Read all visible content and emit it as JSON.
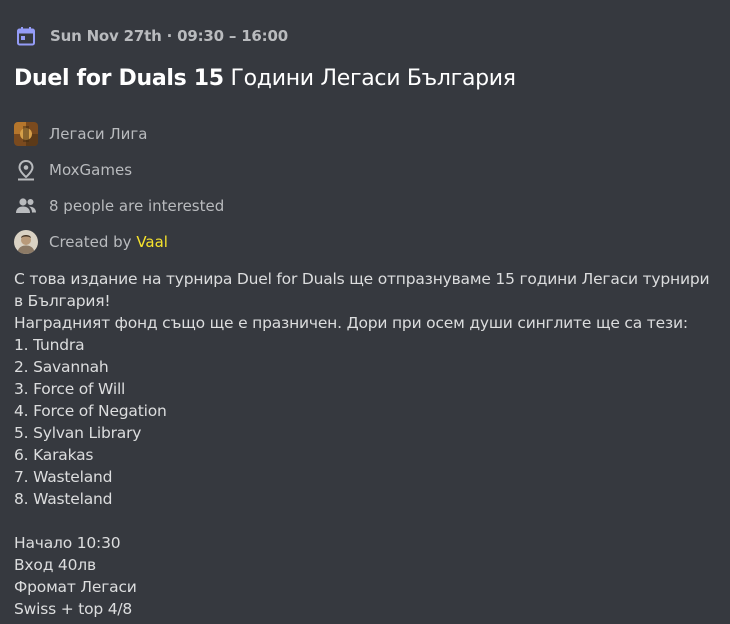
{
  "event": {
    "date": "Sun Nov 27th · 09:30 – 16:00",
    "title_bold": "Duel for Duals 15",
    "title_rest": " Години Легаси България",
    "server_name": "Легаси Лига",
    "location": "MoxGames",
    "interested": "8 people are interested",
    "created_by_label": "Created by ",
    "creator": "Vaal",
    "description": "С това издание на турнира Duel for Duals ще отпразнуваме 15 години Легаси турнири в България!\nНаградният фонд също ще е празничен. Дори при осем души синглите ще са тези:\n1. Tundra\n2. Savannah\n3. Force of Will\n4. Force of Negation\n5. Sylvan Library\n6. Karakas\n7. Wasteland\n8. Wasteland\n\nНачало 10:30\nВход 40лв\nФромат Легаси\nSwiss + top 4/8"
  },
  "icons": {
    "calendar": "calendar-icon",
    "location": "location-pin-icon",
    "people": "people-icon"
  },
  "colors": {
    "background": "#36393f",
    "title": "#ffffff",
    "muted": "#b9bbbe",
    "accent_calendar": "#949cf7",
    "creator": "#f7e32c"
  }
}
